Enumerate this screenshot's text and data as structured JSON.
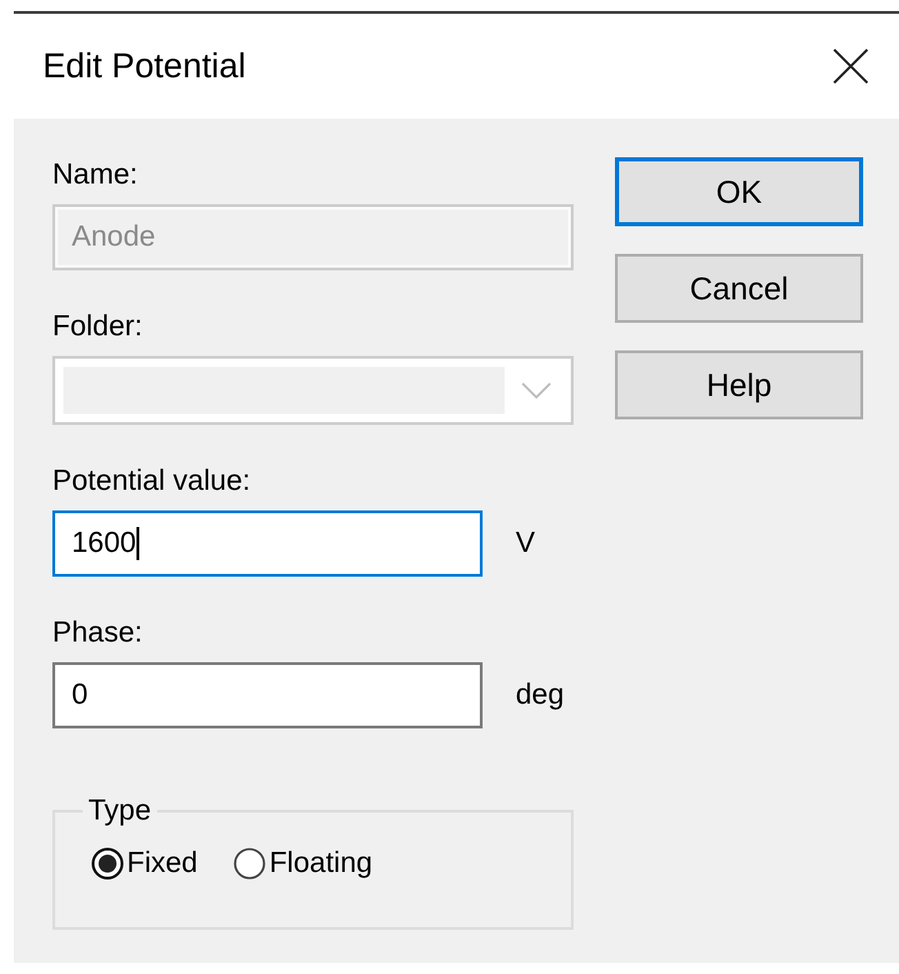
{
  "window": {
    "title": "Edit Potential"
  },
  "fields": [
    {
      "kind": "text",
      "label": "Name:",
      "value": "Anode",
      "disabled": true,
      "focused": false
    },
    {
      "kind": "dropdown",
      "label": "Folder:",
      "disabled": true,
      "focused": false
    },
    {
      "kind": "text",
      "label": "Potential value:",
      "value": "1600",
      "unit": "V",
      "disabled": false,
      "focused": true
    },
    {
      "kind": "text",
      "label": "Phase:",
      "value": "0",
      "unit": "deg",
      "disabled": false,
      "focused": false
    }
  ],
  "type_group": {
    "title": "Type",
    "options": [
      {
        "label": "Fixed",
        "selected": true
      },
      {
        "label": "Floating",
        "selected": false
      }
    ]
  },
  "buttons": [
    {
      "label": "OK",
      "default": true
    },
    {
      "label": "Cancel",
      "default": false
    },
    {
      "label": "Help",
      "default": false
    }
  ]
}
